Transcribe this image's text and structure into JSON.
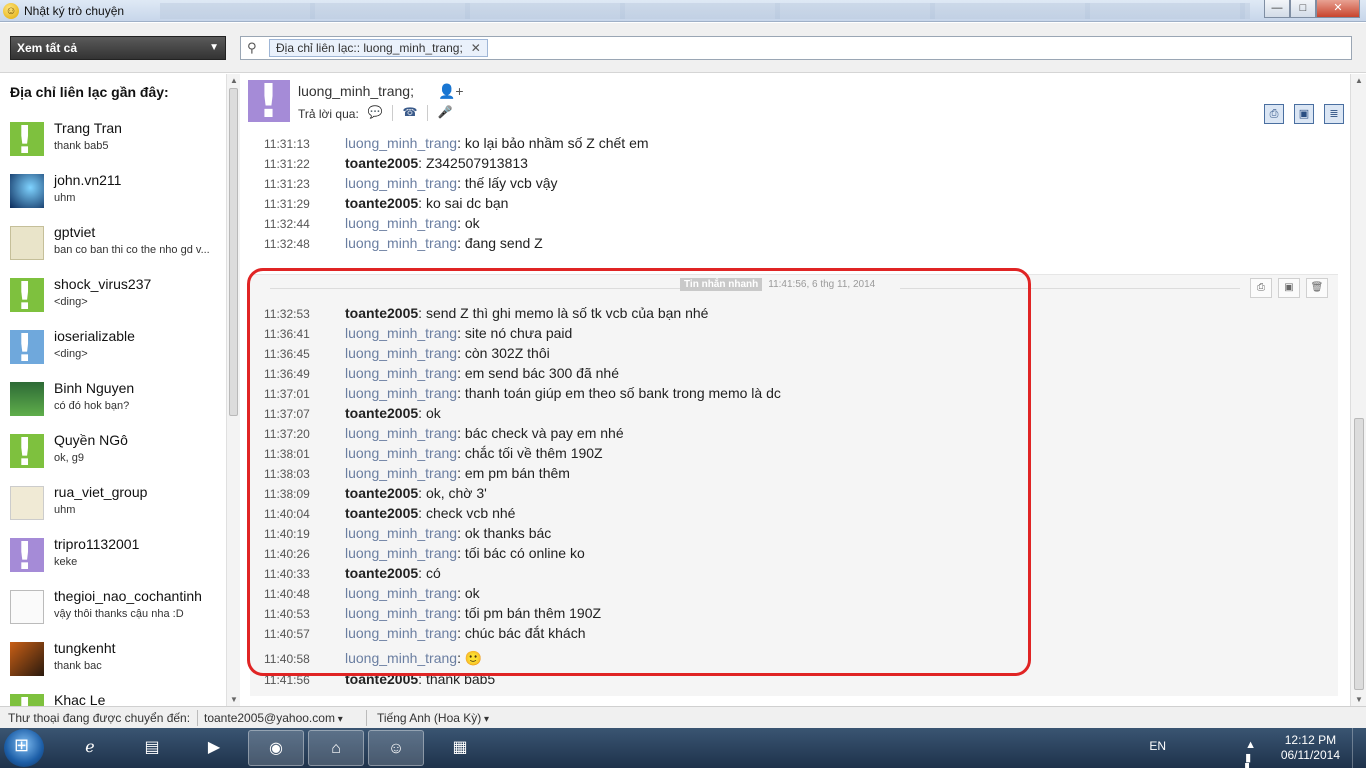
{
  "window": {
    "title": "Nhật ký trò chuyện",
    "controls": {
      "minimize": "—",
      "maximize": "□",
      "close": "✕"
    }
  },
  "toolbar": {
    "view_select": "Xem tất cả",
    "search_chip": "Địa chỉ liên lạc:: luong_minh_trang;"
  },
  "sidebar": {
    "heading": "Địa chỉ liên lạc gần đây:",
    "contacts": [
      {
        "name": "Trang Tran",
        "message": "thank bab5"
      },
      {
        "name": "john.vn211",
        "message": "uhm"
      },
      {
        "name": "gptviet",
        "message": "ban co ban thi co the nho gd v..."
      },
      {
        "name": "shock_virus237",
        "message": "<ding>"
      },
      {
        "name": "ioserializable",
        "message": "<ding>"
      },
      {
        "name": "Binh Nguyen",
        "message": "có đó hok bạn?"
      },
      {
        "name": "Quyền NGô",
        "message": "ok, g9"
      },
      {
        "name": "rua_viet_group",
        "message": "uhm"
      },
      {
        "name": "tripro1132001",
        "message": "keke"
      },
      {
        "name": "thegioi_nao_cochantinh",
        "message": "vậy thôi thanks cậu nha :D"
      },
      {
        "name": "tungkenht",
        "message": "thank bac"
      },
      {
        "name": "Khac Le",
        "message": ""
      }
    ]
  },
  "chat": {
    "contact_name": "luong_minh_trang;",
    "reply_via_label": "Trả lời qua:",
    "session_tag": "Tin nhắn nhanh",
    "session_timestamp": "11:41:56, 6 thg 11, 2014",
    "messages_before": [
      {
        "time": "11:31:13",
        "sender": "luong_minh_trang",
        "text": "ko lại bảo nhầm số Z chết em"
      },
      {
        "time": "11:31:22",
        "sender": "toante2005",
        "text": "Z342507913813"
      },
      {
        "time": "11:31:23",
        "sender": "luong_minh_trang",
        "text": "thế lấy vcb vậy"
      },
      {
        "time": "11:31:29",
        "sender": "toante2005",
        "text": "ko sai dc bạn"
      },
      {
        "time": "11:32:44",
        "sender": "luong_minh_trang",
        "text": "ok"
      },
      {
        "time": "11:32:48",
        "sender": "luong_minh_trang",
        "text": "đang send Z"
      }
    ],
    "messages_session": [
      {
        "time": "11:32:53",
        "sender": "toante2005",
        "text": "send Z thì ghi memo là số tk vcb của bạn nhé"
      },
      {
        "time": "11:36:41",
        "sender": "luong_minh_trang",
        "text": "site nó chưa paid"
      },
      {
        "time": "11:36:45",
        "sender": "luong_minh_trang",
        "text": "còn 302Z thôi"
      },
      {
        "time": "11:36:49",
        "sender": "luong_minh_trang",
        "text": "em send bác 300 đã nhé"
      },
      {
        "time": "11:37:01",
        "sender": "luong_minh_trang",
        "text": "thanh toán giúp em theo số bank trong memo là dc"
      },
      {
        "time": "11:37:07",
        "sender": "toante2005",
        "text": "ok"
      },
      {
        "time": "11:37:20",
        "sender": "luong_minh_trang",
        "text": "bác check và pay em nhé"
      },
      {
        "time": "11:38:01",
        "sender": "luong_minh_trang",
        "text": "chắc tối về thêm 190Z"
      },
      {
        "time": "11:38:03",
        "sender": "luong_minh_trang",
        "text": "em pm bán thêm"
      },
      {
        "time": "11:38:09",
        "sender": "toante2005",
        "text": "ok, chờ 3'"
      },
      {
        "time": "11:40:04",
        "sender": "toante2005",
        "text": "check vcb nhé"
      },
      {
        "time": "11:40:19",
        "sender": "luong_minh_trang",
        "text": "ok thanks bác"
      },
      {
        "time": "11:40:26",
        "sender": "luong_minh_trang",
        "text": "tối bác có online ko"
      },
      {
        "time": "11:40:33",
        "sender": "toante2005",
        "text": "có"
      },
      {
        "time": "11:40:48",
        "sender": "luong_minh_trang",
        "text": "ok"
      },
      {
        "time": "11:40:53",
        "sender": "luong_minh_trang",
        "text": "tối pm bán thêm 190Z"
      },
      {
        "time": "11:40:57",
        "sender": "luong_minh_trang",
        "text": "chúc bác đắt khách"
      },
      {
        "time": "11:40:58",
        "sender": "luong_minh_trang",
        "text": "🙂"
      },
      {
        "time": "11:41:56",
        "sender": "toante2005",
        "text": "thank bab5"
      }
    ]
  },
  "statusbar": {
    "forward_label": "Thư thoại đang được chuyển đến:",
    "forward_email": "toante2005@yahoo.com",
    "language": "Tiếng Anh (Hoa Kỳ)"
  },
  "taskbar": {
    "lang": "EN",
    "time": "12:12 PM",
    "date": "06/11/2014"
  },
  "colors": {
    "highlight_border": "#e02424",
    "other_sender": "#6a7ea1",
    "self_sender": "#222222"
  }
}
